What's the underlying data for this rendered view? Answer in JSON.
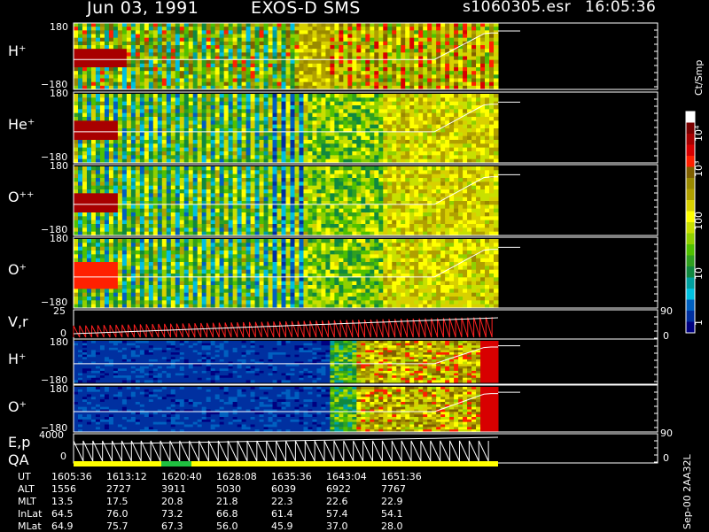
{
  "header": {
    "date": "Jun 03, 1991",
    "instrument": "EXOS-D SMS",
    "file": "s1060305.esr",
    "time": "16:05:36"
  },
  "colorbar": {
    "unit_label": "Ct/Smp",
    "ticks": [
      "10⁴",
      "10³",
      "100",
      "10",
      "1"
    ],
    "colors": [
      "#ffffff",
      "#7a0000",
      "#a80000",
      "#d80000",
      "#ff2000",
      "#806000",
      "#9a8a00",
      "#b0a000",
      "#d8d000",
      "#ffff00",
      "#c8e000",
      "#90d000",
      "#50c000",
      "#30a020",
      "#108840",
      "#00a0a0",
      "#00c0e0",
      "#0060c0",
      "#0030a0",
      "#000080"
    ]
  },
  "chart_data": [
    {
      "type": "heatmap",
      "panel": "H+ (spin-phase)",
      "ylabel": "H⁺",
      "ylim": [
        -180,
        180
      ],
      "yticks": [
        "180",
        "−180"
      ]
    },
    {
      "type": "heatmap",
      "panel": "He+ (spin-phase)",
      "ylabel": "He⁺",
      "ylim": [
        -180,
        180
      ],
      "yticks": [
        "180",
        "−180"
      ]
    },
    {
      "type": "heatmap",
      "panel": "O++ (spin-phase)",
      "ylabel": "O⁺⁺",
      "ylim": [
        -180,
        180
      ],
      "yticks": [
        "180",
        "−180"
      ]
    },
    {
      "type": "heatmap",
      "panel": "O+ (spin-phase)",
      "ylabel": "O⁺",
      "ylim": [
        -180,
        180
      ],
      "yticks": [
        "180",
        "−180"
      ]
    },
    {
      "type": "line",
      "panel": "V,r",
      "ylabel": "V,r",
      "ylim": [
        0,
        25
      ],
      "yticks": [
        "25",
        "0"
      ],
      "right_ticks": [
        "90",
        "0"
      ]
    },
    {
      "type": "heatmap",
      "panel": "H+ (energy-time)",
      "ylabel": "H⁺",
      "ylim": [
        -180,
        180
      ],
      "yticks": [
        "180",
        "−180"
      ]
    },
    {
      "type": "heatmap",
      "panel": "O+ (energy-time)",
      "ylabel": "O⁺",
      "ylim": [
        -180,
        180
      ],
      "yticks": [
        "180",
        "−180"
      ]
    },
    {
      "type": "line",
      "panel": "E,p",
      "ylabel": "E,p",
      "ylim": [
        0,
        4000
      ],
      "yticks": [
        "4000",
        "0"
      ],
      "right_ticks": [
        "90",
        "0"
      ]
    }
  ],
  "qa": {
    "label": "QA"
  },
  "ephemeris": {
    "rows": [
      {
        "label": "UT",
        "values": [
          "1605:36",
          "1613:12",
          "1620:40",
          "1628:08",
          "1635:36",
          "1643:04",
          "1651:36"
        ]
      },
      {
        "label": "ALT",
        "values": [
          "1556",
          "2727",
          "3911",
          "5030",
          "6039",
          "6922",
          "7767"
        ]
      },
      {
        "label": "MLT",
        "values": [
          "13.5",
          "17.5",
          "20.8",
          "21.8",
          "22.3",
          "22.6",
          "22.9"
        ]
      },
      {
        "label": "InLat",
        "values": [
          "64.5",
          "76.0",
          "73.2",
          "66.8",
          "61.4",
          "57.4",
          "54.1"
        ]
      },
      {
        "label": "MLat",
        "values": [
          "64.9",
          "75.7",
          "67.3",
          "56.0",
          "45.9",
          "37.0",
          "28.0"
        ]
      }
    ]
  },
  "footer": {
    "version": "Sep-00 2AA32L"
  }
}
